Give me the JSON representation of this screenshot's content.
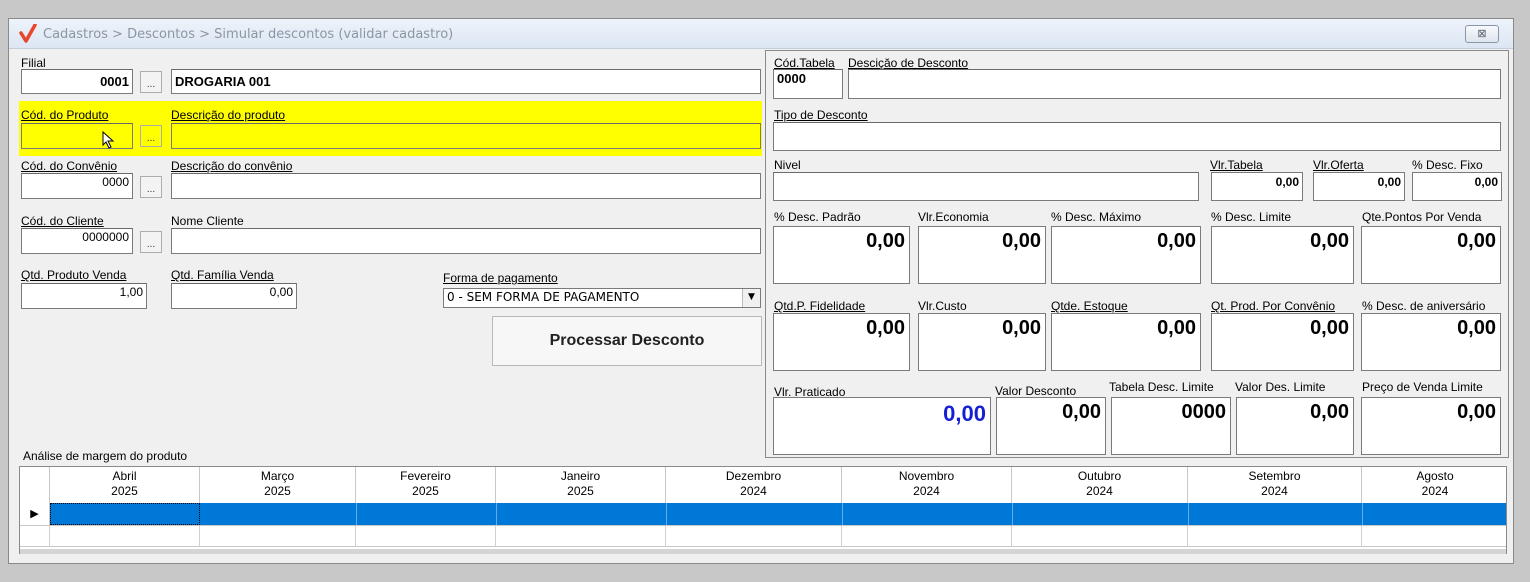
{
  "window": {
    "title": "Cadastros > Descontos > Simular descontos (validar cadastro)",
    "close": "⊠"
  },
  "left": {
    "filial_label": "Filial",
    "filial_code": "0001",
    "filial_name": "DROGARIA 001",
    "produto_code_label": "Cód. do Produto",
    "produto_desc_label": "Descrição  do produto",
    "produto_code": "",
    "produto_desc": "",
    "convenio_code_label": "Cód. do Convênio",
    "convenio_desc_label": "Descrição  do convênio",
    "convenio_code": "0000",
    "convenio_desc": "",
    "cliente_code_label": "Cód. do Cliente",
    "cliente_name_label": "Nome Cliente",
    "cliente_code": "0000000",
    "cliente_name": "",
    "qtd_prod_label": "Qtd. Produto Venda",
    "qtd_prod": "1,00",
    "qtd_fam_label": "Qtd. Família Venda",
    "qtd_fam": "0,00",
    "forma_label": "Forma de pagamento",
    "forma_value": "0 - SEM FORMA DE PAGAMENTO",
    "process_button": "Processar Desconto",
    "ellipsis": "..."
  },
  "right": {
    "cod_tabela_label": "Cód.Tabela",
    "cod_tabela": "0000",
    "desc_desconto_label": "Desciçăo de Desconto",
    "desc_desconto": "",
    "tipo_label": "Tipo de Desconto",
    "tipo": "",
    "nivel_label": "Nivel",
    "nivel": "",
    "vlr_tabela_label": "Vlr.Tabela",
    "vlr_tabela": "0,00",
    "vlr_oferta_label": "Vlr.Oferta",
    "vlr_oferta": "0,00",
    "desc_fixo_label": "% Desc. Fixo",
    "desc_fixo": "0,00",
    "desc_padrao_label": "% Desc. Padrão",
    "desc_padrao": "0,00",
    "vlr_economia_label": "Vlr.Economia",
    "vlr_economia": "0,00",
    "desc_maximo_label": "% Desc. Máximo",
    "desc_maximo": "0,00",
    "desc_limite_label": "% Desc. Limite",
    "desc_limite": "0,00",
    "qte_pontos_label": "Qte.Pontos Por Venda",
    "qte_pontos": "0,00",
    "qtd_fidelidade_label": "Qtd.P. Fidelidade",
    "qtd_fidelidade": "0,00",
    "vlr_custo_label": "Vlr.Custo",
    "vlr_custo": "0,00",
    "qtde_estoque_label": "Qtde. Estoque",
    "qtde_estoque": "0,00",
    "qt_prod_conv_label": "Qt. Prod. Por Convênio",
    "qt_prod_conv": "0,00",
    "desc_aniv_label": "% Desc. de aniversário",
    "desc_aniv": "0,00",
    "vlr_praticado_label": "Vlr. Praticado",
    "vlr_praticado": "0,00",
    "valor_desconto_label": "Valor Desconto",
    "valor_desconto": "0,00",
    "tabela_desc_limite_label": "Tabela Desc. Limite",
    "tabela_desc_limite": "0000",
    "valor_des_limite_label": "Valor Des. Limite",
    "valor_des_limite": "0,00",
    "preco_venda_limite_label": "Preço de Venda Limite",
    "preco_venda_limite": "0,00"
  },
  "grid": {
    "caption": "Análise de margem do produto",
    "row_marker": "▶",
    "columns": [
      {
        "month": "Abril",
        "year": "2025"
      },
      {
        "month": "Março",
        "year": "2025"
      },
      {
        "month": "Fevereiro",
        "year": "2025"
      },
      {
        "month": "Janeiro",
        "year": "2025"
      },
      {
        "month": "Dezembro",
        "year": "2024"
      },
      {
        "month": "Novembro",
        "year": "2024"
      },
      {
        "month": "Outubro",
        "year": "2024"
      },
      {
        "month": "Setembro",
        "year": "2024"
      },
      {
        "month": "Agosto",
        "year": "2024"
      }
    ],
    "selected_row_color": "#0078d7"
  },
  "colors": {
    "highlight": "#ffff00",
    "accent_value": "#1520d6",
    "logo": "#e8452c"
  }
}
